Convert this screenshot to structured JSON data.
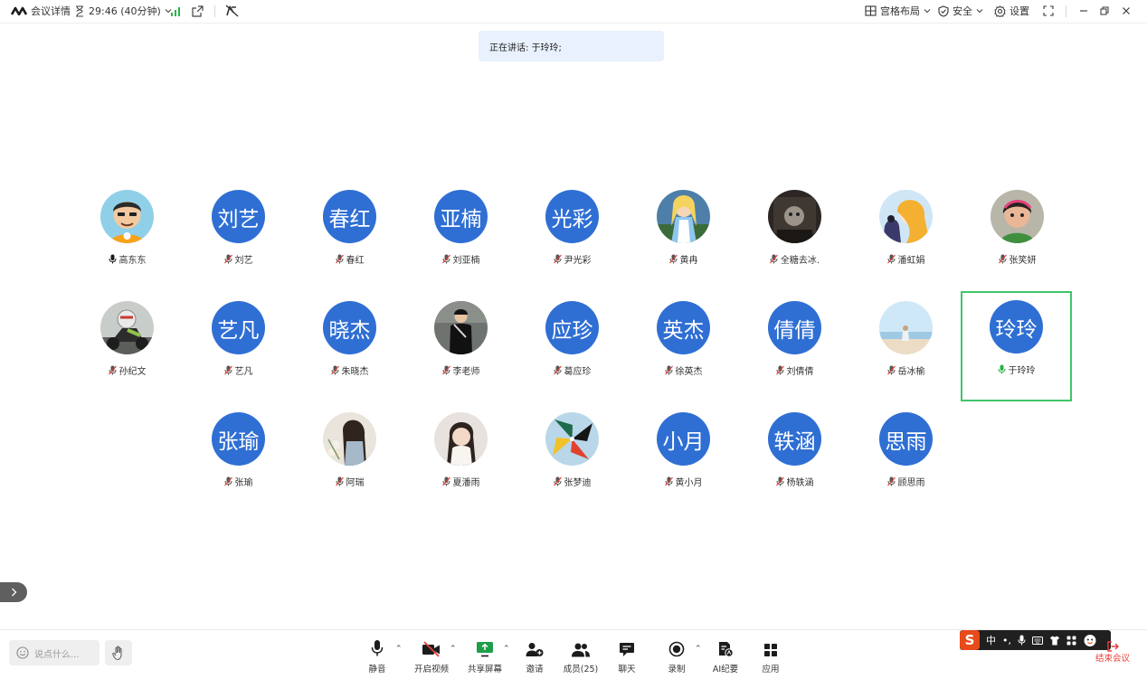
{
  "topbar": {
    "meeting_details": "会议详情",
    "timer": "29:46 (40分钟)",
    "grid_layout": "宫格布局",
    "security": "安全",
    "settings": "设置"
  },
  "speaking_banner": "正在讲话: 于玲玲;",
  "participants": [
    {
      "name": "高东东",
      "avatar_text": "",
      "avatar_image": "cartoon-man-photo",
      "mic": "on"
    },
    {
      "name": "刘艺",
      "avatar_text": "刘艺",
      "mic": "muted"
    },
    {
      "name": "春红",
      "avatar_text": "春红",
      "mic": "muted"
    },
    {
      "name": "刘亚楠",
      "avatar_text": "亚楠",
      "mic": "muted"
    },
    {
      "name": "尹光彩",
      "avatar_text": "光彩",
      "mic": "muted"
    },
    {
      "name": "黄冉",
      "avatar_text": "",
      "avatar_image": "alice-cartoon-photo",
      "mic": "muted"
    },
    {
      "name": "全糖去冰.",
      "avatar_text": "",
      "avatar_image": "dark-room-photo",
      "mic": "muted"
    },
    {
      "name": "潘虹娟",
      "avatar_text": "",
      "avatar_image": "anime-girl-photo",
      "mic": "muted"
    },
    {
      "name": "张笑妍",
      "avatar_text": "",
      "avatar_image": "cartoon-girl-photo",
      "mic": "muted"
    },
    {
      "name": "孙纪文",
      "avatar_text": "",
      "avatar_image": "motorcycle-photo",
      "mic": "muted"
    },
    {
      "name": "艺凡",
      "avatar_text": "艺凡",
      "mic": "muted"
    },
    {
      "name": "朱晓杰",
      "avatar_text": "晓杰",
      "mic": "muted"
    },
    {
      "name": "李老师",
      "avatar_text": "",
      "avatar_image": "man-street-photo",
      "mic": "muted"
    },
    {
      "name": "葛应珍",
      "avatar_text": "应珍",
      "mic": "muted"
    },
    {
      "name": "徐英杰",
      "avatar_text": "英杰",
      "mic": "muted"
    },
    {
      "name": "刘倩倩",
      "avatar_text": "倩倩",
      "mic": "muted"
    },
    {
      "name": "岳冰榆",
      "avatar_text": "",
      "avatar_image": "beach-photo",
      "mic": "muted"
    },
    {
      "name": "于玲玲",
      "avatar_text": "玲玲",
      "mic": "speaking",
      "active": true
    },
    {
      "name": "张瑜",
      "avatar_text": "张瑜",
      "mic": "muted"
    },
    {
      "name": "阿瑞",
      "avatar_text": "",
      "avatar_image": "girl-flowers-photo",
      "mic": "muted"
    },
    {
      "name": "夏潘雨",
      "avatar_text": "",
      "avatar_image": "girl-portrait-photo",
      "mic": "muted"
    },
    {
      "name": "张梦迪",
      "avatar_text": "",
      "avatar_image": "pinwheel-photo",
      "mic": "muted"
    },
    {
      "name": "黄小月",
      "avatar_text": "小月",
      "mic": "muted"
    },
    {
      "name": "杨轶涵",
      "avatar_text": "轶涵",
      "mic": "muted"
    },
    {
      "name": "顾思雨",
      "avatar_text": "思雨",
      "mic": "muted"
    }
  ],
  "bottombar": {
    "say_placeholder": "说点什么...",
    "tools": [
      {
        "id": "mute",
        "label": "静音",
        "icon": "microphone-icon"
      },
      {
        "id": "video",
        "label": "开启视频",
        "icon": "video-off-icon"
      },
      {
        "id": "share",
        "label": "共享屏幕",
        "icon": "share-screen-icon"
      },
      {
        "id": "invite",
        "label": "邀请",
        "icon": "add-user-icon"
      },
      {
        "id": "members",
        "label": "成员(25)",
        "icon": "members-icon"
      },
      {
        "id": "chat",
        "label": "聊天",
        "icon": "chat-icon"
      },
      {
        "id": "record",
        "label": "录制",
        "icon": "record-icon"
      },
      {
        "id": "ai",
        "label": "AI纪要",
        "icon": "ai-notes-icon"
      },
      {
        "id": "apps",
        "label": "应用",
        "icon": "apps-icon"
      }
    ],
    "ime": {
      "lang": "中",
      "punct": "•,"
    },
    "end_meeting": "结束会议"
  },
  "colors": {
    "avatar_blue": "#2f6fd4",
    "active_border": "#3fc66a",
    "speaking_bg": "#e8f1fd",
    "end_red": "#e5413b"
  }
}
